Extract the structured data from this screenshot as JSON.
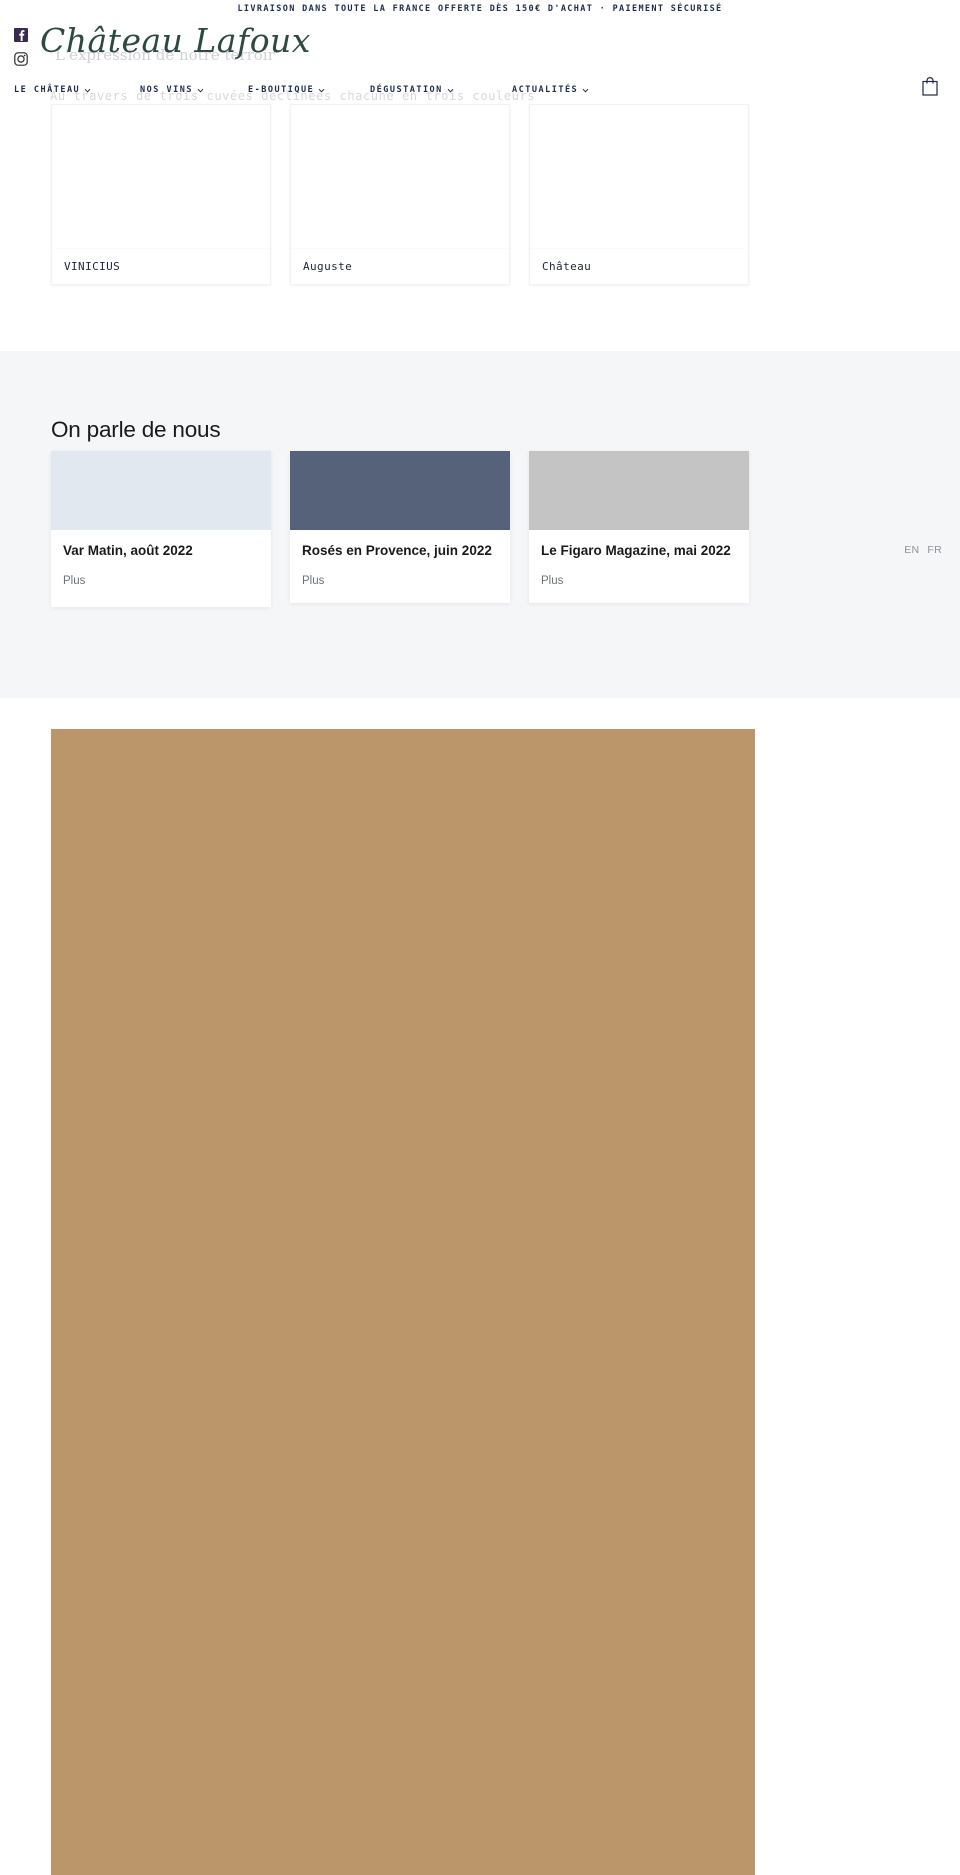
{
  "announcement": {
    "text": "LIVRAISON DANS TOUTE LA FRANCE OFFERTE DÈS 150€ D'ACHAT · PAIEMENT SÉCURISÉ"
  },
  "social": [
    {
      "name": "facebook-icon",
      "label": "Facebook"
    },
    {
      "name": "instagram-icon",
      "label": "Instagram"
    }
  ],
  "brand": {
    "name": "Château Lafoux",
    "tagline": "L'expression de notre terroir",
    "color": "#2c4a42"
  },
  "nav": {
    "items": [
      {
        "label": "LE CHÂTEAU",
        "has_dropdown": true
      },
      {
        "label": "NOS VINS",
        "has_dropdown": true
      },
      {
        "label": "E-BOUTIQUE",
        "has_dropdown": true
      },
      {
        "label": "DÉGUSTATION",
        "has_dropdown": true
      },
      {
        "label": "ACTUALITÉS",
        "has_dropdown": true
      }
    ],
    "cart_icon": "shopping-bag-icon"
  },
  "intro": {
    "line": "Au travers de trois cuvées déclinées chacune en trois couleurs"
  },
  "cuvees": [
    {
      "label": "VINICIUS"
    },
    {
      "label": "Auguste"
    },
    {
      "label": "Château"
    }
  ],
  "press": {
    "title": "On parle de nous",
    "background": "#f5f6f8",
    "cards": [
      {
        "title": "Var Matin, août 2022",
        "more_label": "Plus",
        "image_color": "#e2e8f0"
      },
      {
        "title": "Rosés en Provence, juin 2022",
        "more_label": "Plus",
        "image_color": "#566279"
      },
      {
        "title": "Le Figaro Magazine, mai 2022",
        "more_label": "Plus",
        "image_color": "#c4c4c4"
      }
    ]
  },
  "language": {
    "options": [
      {
        "code": "EN"
      },
      {
        "code": "FR"
      }
    ]
  },
  "bottom_banner": {
    "color": "#bb966b"
  }
}
